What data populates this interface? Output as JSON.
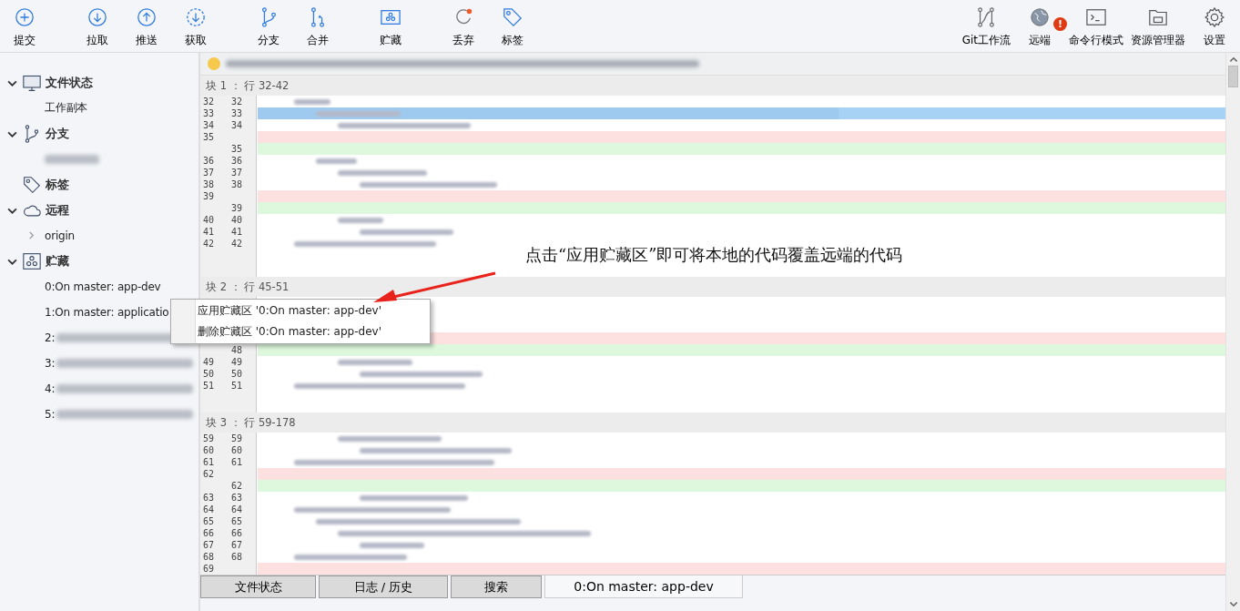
{
  "toolbar": {
    "left": [
      {
        "label": "提交"
      },
      {
        "label": "拉取"
      },
      {
        "label": "推送"
      },
      {
        "label": "获取"
      },
      {
        "label": "分支"
      },
      {
        "label": "合并"
      },
      {
        "label": "贮藏"
      },
      {
        "label": "丢弃"
      },
      {
        "label": "标签"
      }
    ],
    "right": [
      {
        "label": "Git工作流"
      },
      {
        "label": "远端",
        "badge": "!"
      },
      {
        "label": "命令行模式"
      },
      {
        "label": "资源管理器"
      },
      {
        "label": "设置"
      }
    ]
  },
  "sidebar": {
    "sections": [
      {
        "title": "文件状态",
        "expanded": true,
        "children": [
          {
            "label": "工作副本",
            "kind": "item"
          }
        ]
      },
      {
        "title": "分支",
        "expanded": true,
        "children": [
          {
            "kind": "blurred"
          }
        ]
      },
      {
        "title": "标签",
        "expanded": false
      },
      {
        "title": "远程",
        "expanded": true,
        "children": [
          {
            "label": "origin",
            "kind": "group"
          }
        ]
      },
      {
        "title": "贮藏",
        "expanded": true,
        "children": [
          {
            "label": "0:On master: app-dev",
            "kind": "item"
          },
          {
            "label": "1:On master: applicatio",
            "kind": "item"
          },
          {
            "label": "2:",
            "kind": "partial"
          },
          {
            "label": "3:",
            "kind": "partial"
          },
          {
            "label": "4:",
            "kind": "partial"
          },
          {
            "label": "5:",
            "kind": "partial"
          }
        ]
      }
    ]
  },
  "diff": {
    "hunks": [
      {
        "title": "块 1 ： 行 32-42",
        "rows": [
          {
            "old": "32",
            "new": "32",
            "kind": "normal"
          },
          {
            "old": "33",
            "new": "33",
            "kind": "selected"
          },
          {
            "old": "34",
            "new": "34",
            "kind": "normal"
          },
          {
            "old": "35",
            "kind": "removed"
          },
          {
            "new": "35",
            "kind": "added"
          },
          {
            "old": "36",
            "new": "36",
            "kind": "normal"
          },
          {
            "old": "37",
            "new": "37",
            "kind": "normal"
          },
          {
            "old": "38",
            "new": "38",
            "kind": "normal"
          },
          {
            "old": "39",
            "kind": "removed"
          },
          {
            "new": "39",
            "kind": "added"
          },
          {
            "old": "40",
            "new": "40",
            "kind": "normal"
          },
          {
            "old": "41",
            "new": "41",
            "kind": "normal"
          },
          {
            "old": "42",
            "new": "42",
            "kind": "normal"
          }
        ]
      },
      {
        "title": "块 2 ： 行 45-51",
        "rows": [
          {
            "kind": "normal"
          },
          {
            "kind": "normal"
          },
          {
            "kind": "normal"
          },
          {
            "kind": "removed"
          },
          {
            "new": "48",
            "kind": "added"
          },
          {
            "old": "49",
            "new": "49",
            "kind": "normal"
          },
          {
            "old": "50",
            "new": "50",
            "kind": "normal"
          },
          {
            "old": "51",
            "new": "51",
            "kind": "normal"
          }
        ]
      },
      {
        "title": "块 3 ： 行 59-178",
        "rows": [
          {
            "old": "59",
            "new": "59",
            "kind": "normal"
          },
          {
            "old": "60",
            "new": "60",
            "kind": "normal"
          },
          {
            "old": "61",
            "new": "61",
            "kind": "normal"
          },
          {
            "old": "62",
            "kind": "removed"
          },
          {
            "new": "62",
            "kind": "added"
          },
          {
            "old": "63",
            "new": "63",
            "kind": "normal"
          },
          {
            "old": "64",
            "new": "64",
            "kind": "normal"
          },
          {
            "old": "65",
            "new": "65",
            "kind": "normal"
          },
          {
            "old": "66",
            "new": "66",
            "kind": "normal"
          },
          {
            "old": "67",
            "new": "67",
            "kind": "normal"
          },
          {
            "old": "68",
            "new": "68",
            "kind": "normal"
          },
          {
            "old": "69",
            "kind": "removed"
          }
        ]
      }
    ]
  },
  "context_menu": {
    "items": [
      "应用贮藏区 '0:On master: app-dev'",
      "删除贮藏区 '0:On master: app-dev'"
    ]
  },
  "annotation": {
    "text": "点击“应用贮藏区”即可将本地的代码覆盖远端的代码"
  },
  "bottom_tabs": [
    {
      "label": "文件状态",
      "selected": false
    },
    {
      "label": "日志 / 历史",
      "selected": false
    },
    {
      "label": "搜索",
      "selected": false
    },
    {
      "label": "0:On master: app-dev",
      "selected": true
    }
  ]
}
